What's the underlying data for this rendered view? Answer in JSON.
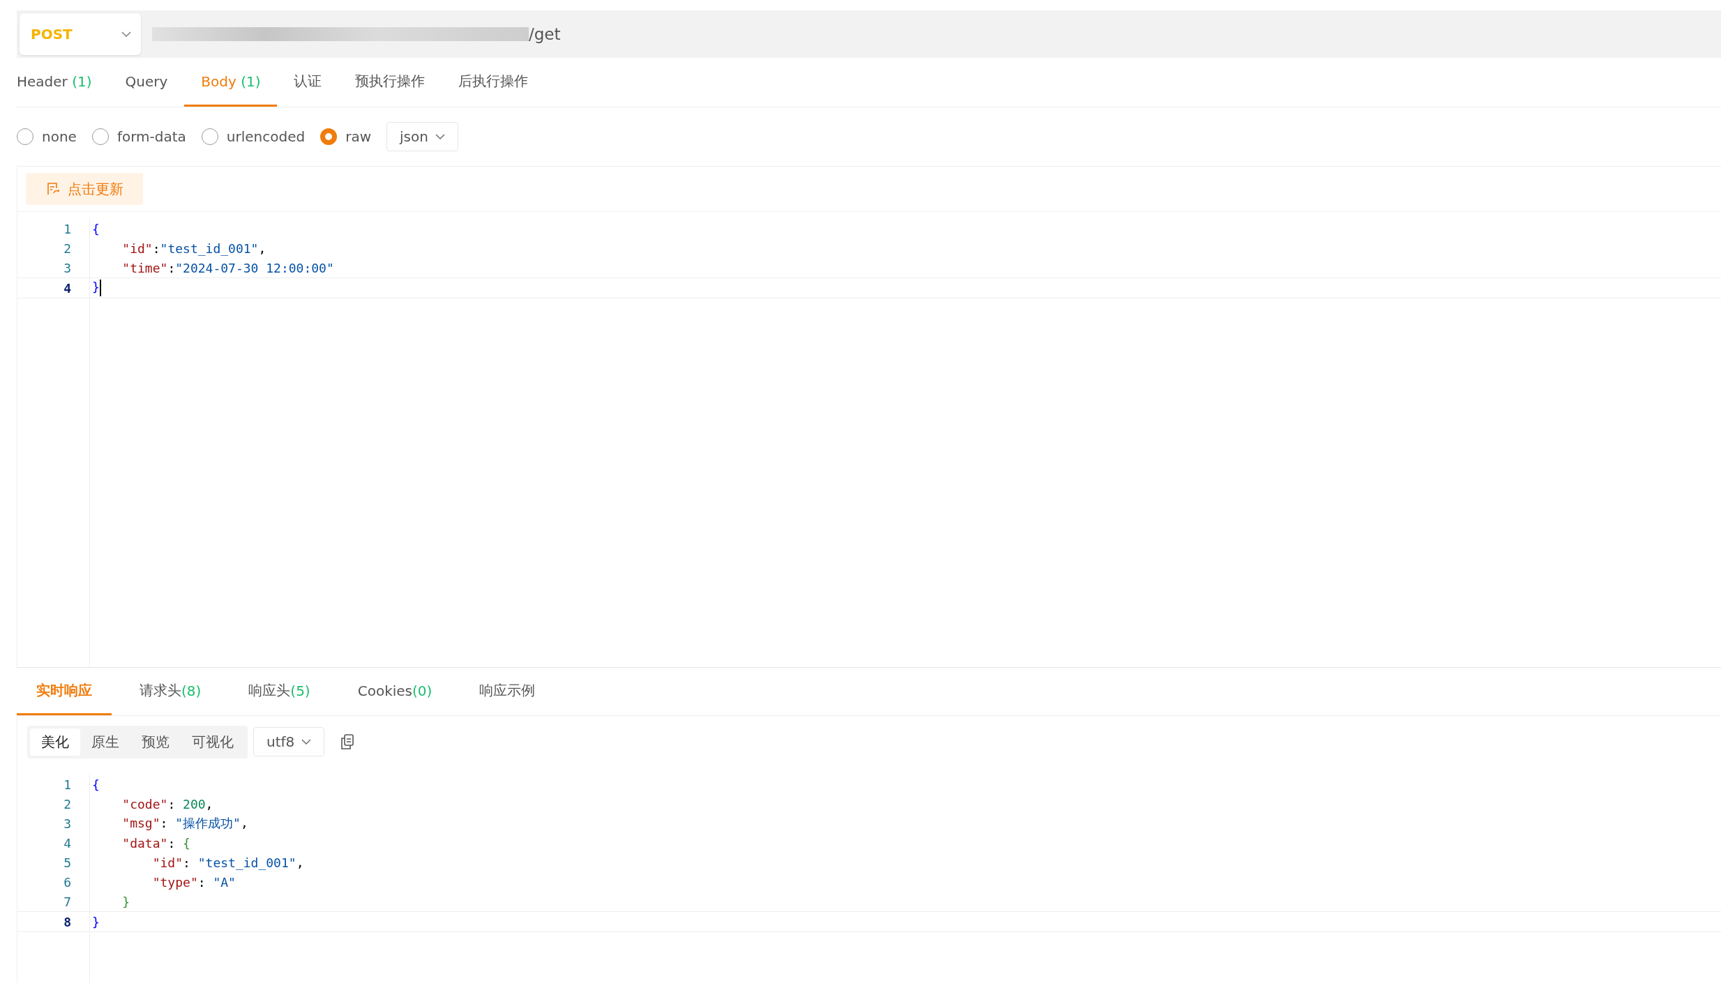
{
  "request": {
    "method": "POST",
    "url": "/get"
  },
  "request_tabs": [
    {
      "label": "Header",
      "count": "(1)",
      "selected": false
    },
    {
      "label": "Query",
      "selected": false
    },
    {
      "label": "Body",
      "count": "(1)",
      "selected": true
    },
    {
      "label": "认证",
      "selected": false
    },
    {
      "label": "预执行操作",
      "selected": false
    },
    {
      "label": "后执行操作",
      "selected": false
    }
  ],
  "body_types": [
    {
      "label": "none",
      "selected": false
    },
    {
      "label": "form-data",
      "selected": false
    },
    {
      "label": "urlencoded",
      "selected": false
    },
    {
      "label": "raw",
      "selected": true
    }
  ],
  "format": "json",
  "refresh_button": "点击更新",
  "request_body": {
    "lines": [
      {
        "number": "1",
        "active": false,
        "tokens": [
          {
            "kind": "brace",
            "text": "{"
          }
        ]
      },
      {
        "number": "2",
        "active": false,
        "tokens": [
          {
            "kind": "key",
            "text": "    \"id\""
          },
          {
            "kind": "punct",
            "text": ":"
          },
          {
            "kind": "string",
            "text": "\"test_id_001\""
          },
          {
            "kind": "punct",
            "text": ","
          }
        ]
      },
      {
        "number": "3",
        "active": false,
        "tokens": [
          {
            "kind": "key",
            "text": "    \"time\""
          },
          {
            "kind": "punct",
            "text": ":"
          },
          {
            "kind": "string",
            "text": "\"2024-07-30 12:00:00\""
          }
        ]
      },
      {
        "number": "4",
        "active": true,
        "tokens": [
          {
            "kind": "brace",
            "text": "}"
          }
        ]
      }
    ]
  },
  "response_tabs": [
    {
      "label": "实时响应",
      "selected": true
    },
    {
      "label": "请求头",
      "count": "(8)",
      "selected": false
    },
    {
      "label": "响应头",
      "count": "(5)",
      "selected": false
    },
    {
      "label": "Cookies",
      "count": "(0)",
      "selected": false
    },
    {
      "label": "响应示例",
      "selected": false
    }
  ],
  "view_modes": [
    {
      "label": "美化",
      "selected": true
    },
    {
      "label": "原生",
      "selected": false
    },
    {
      "label": "预览",
      "selected": false
    },
    {
      "label": "可视化",
      "selected": false
    }
  ],
  "encoding": "utf8",
  "response_body": {
    "lines": [
      {
        "number": "1",
        "active": false,
        "tokens": [
          {
            "kind": "brace",
            "text": "{"
          }
        ]
      },
      {
        "number": "2",
        "active": false,
        "tokens": [
          {
            "kind": "key",
            "text": "    \"code\""
          },
          {
            "kind": "punct",
            "text": ": "
          },
          {
            "kind": "number",
            "text": "200"
          },
          {
            "kind": "punct",
            "text": ","
          }
        ]
      },
      {
        "number": "3",
        "active": false,
        "tokens": [
          {
            "kind": "key",
            "text": "    \"msg\""
          },
          {
            "kind": "punct",
            "text": ": "
          },
          {
            "kind": "string",
            "text": "\"操作成功\""
          },
          {
            "kind": "punct",
            "text": ","
          }
        ]
      },
      {
        "number": "4",
        "active": false,
        "tokens": [
          {
            "kind": "key",
            "text": "    \"data\""
          },
          {
            "kind": "punct",
            "text": ": "
          },
          {
            "kind": "brace2",
            "text": "{"
          }
        ]
      },
      {
        "number": "5",
        "active": false,
        "tokens": [
          {
            "kind": "key",
            "text": "        \"id\""
          },
          {
            "kind": "punct",
            "text": ": "
          },
          {
            "kind": "string",
            "text": "\"test_id_001\""
          },
          {
            "kind": "punct",
            "text": ","
          }
        ]
      },
      {
        "number": "6",
        "active": false,
        "tokens": [
          {
            "kind": "key",
            "text": "        \"type\""
          },
          {
            "kind": "punct",
            "text": ": "
          },
          {
            "kind": "string",
            "text": "\"A\""
          }
        ]
      },
      {
        "number": "7",
        "active": false,
        "tokens": [
          {
            "kind": "brace2",
            "text": "    }"
          }
        ]
      },
      {
        "number": "8",
        "active": true,
        "tokens": [
          {
            "kind": "brace",
            "text": "}"
          }
        ]
      }
    ]
  }
}
